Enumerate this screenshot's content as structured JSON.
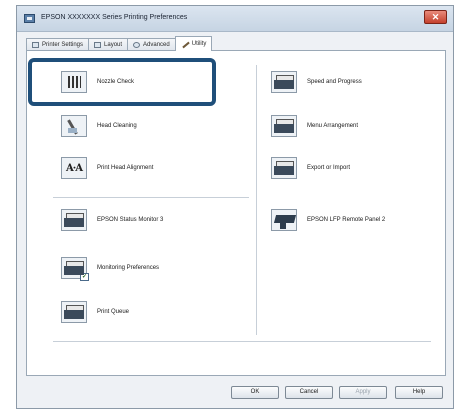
{
  "window": {
    "title": "EPSON XXXXXXX Series Printing Preferences",
    "close_glyph": "✕"
  },
  "tabs": [
    {
      "label": "Printer Settings",
      "icon": "printer-icon"
    },
    {
      "label": "Layout",
      "icon": "layout-icon"
    },
    {
      "label": "Advanced",
      "icon": "advanced-icon"
    },
    {
      "label": "Utility",
      "icon": "utility-pen-icon",
      "active": true
    }
  ],
  "utility": {
    "left": [
      {
        "label": "Nozzle Check",
        "icon": "nozzle-check-icon",
        "highlighted": true
      },
      {
        "label": "Head Cleaning",
        "icon": "head-cleaning-icon"
      },
      {
        "label": "Print Head Alignment",
        "icon": "print-head-alignment-icon",
        "icon_text": "A·A"
      },
      {
        "label": "EPSON Status Monitor 3",
        "icon": "status-monitor-icon"
      },
      {
        "label": "Monitoring Preferences",
        "icon": "monitoring-preferences-icon",
        "badge": "✓"
      },
      {
        "label": "Print Queue",
        "icon": "print-queue-icon"
      }
    ],
    "right": [
      {
        "label": "Speed and Progress",
        "icon": "speed-progress-icon"
      },
      {
        "label": "Menu Arrangement",
        "icon": "menu-arrangement-icon"
      },
      {
        "label": "Export or Import",
        "icon": "export-import-icon"
      },
      {
        "label": "EPSON LFP Remote Panel 2",
        "icon": "lfp-remote-panel-icon"
      }
    ]
  },
  "buttons": {
    "ok": "OK",
    "cancel": "Cancel",
    "apply": "Apply",
    "help": "Help"
  },
  "colors": {
    "highlight": "#1f4f7a",
    "close_button": "#c4412d"
  }
}
